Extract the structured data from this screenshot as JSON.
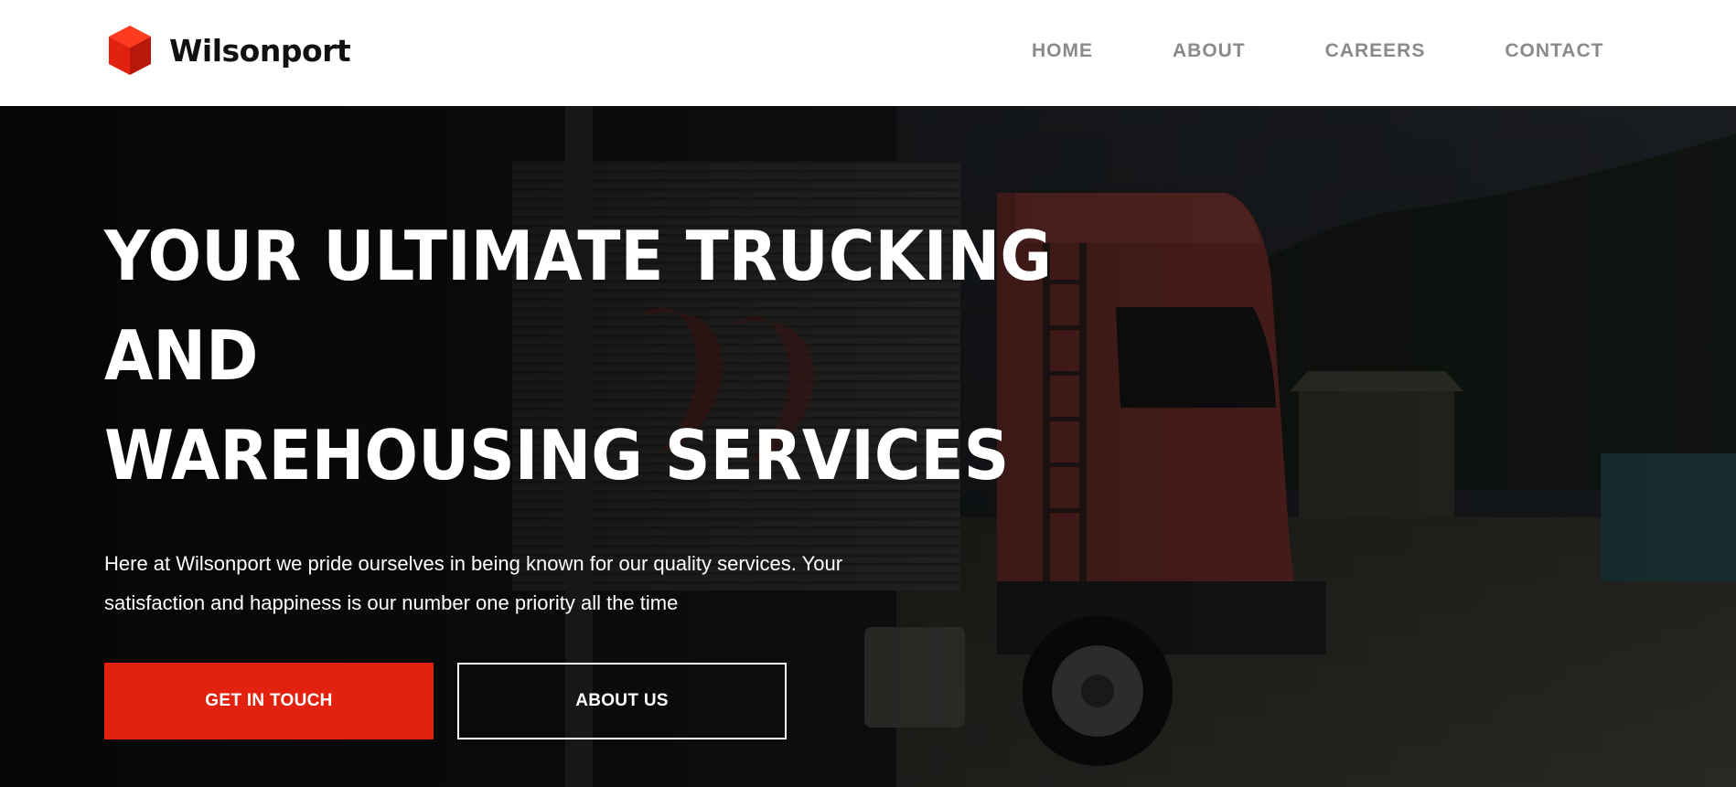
{
  "brand": {
    "name": "Wilsonport",
    "logo_icon": "red-cube-icon",
    "accent_color": "#e2220f"
  },
  "nav": {
    "items": [
      {
        "label": "HOME"
      },
      {
        "label": "ABOUT"
      },
      {
        "label": "CAREERS"
      },
      {
        "label": "CONTACT"
      }
    ]
  },
  "hero": {
    "headline_line1": "YOUR ULTIMATE TRUCKING AND",
    "headline_line2": "WAREHOUSING SERVICES",
    "subtext": "Here at Wilsonport we pride ourselves in being known for our quality services. Your satisfaction and happiness is our number one priority all the time",
    "primary_button": "GET IN TOUCH",
    "secondary_button": "ABOUT US",
    "background_image": "dark-red-truck-photo"
  }
}
